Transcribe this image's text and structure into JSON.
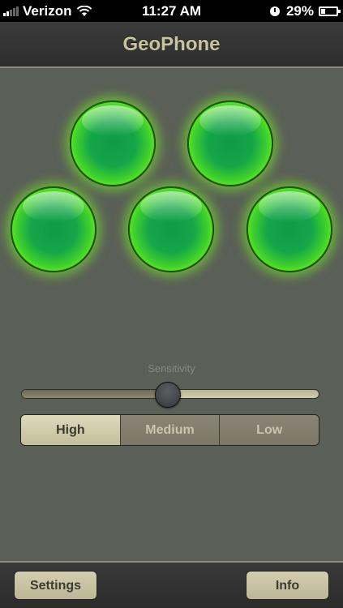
{
  "status_bar": {
    "carrier": "Verizon",
    "time": "11:27 AM",
    "battery_percent": "29%",
    "battery_level": 0.29,
    "icons": [
      "signal-bars-icon",
      "wifi-icon",
      "alarm-clock-icon",
      "battery-charging-icon"
    ]
  },
  "navbar": {
    "title": "GeoPhone"
  },
  "lights": {
    "count": 5,
    "color": "#7bff18",
    "state": "lit"
  },
  "sensitivity": {
    "label": "Sensitivity",
    "slider_value": 0.49,
    "options": [
      "High",
      "Medium",
      "Low"
    ],
    "selected": "High"
  },
  "toolbar": {
    "settings_label": "Settings",
    "info_label": "Info"
  },
  "colors": {
    "accent": "#c8c39c",
    "background": "#5a5f57",
    "light_glow": "#7bff18",
    "light_core": "#14a549"
  }
}
